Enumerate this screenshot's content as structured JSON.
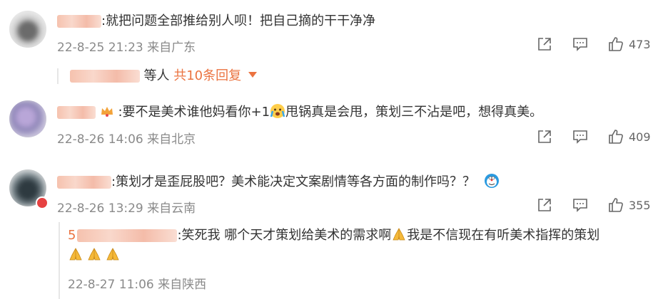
{
  "comments": [
    {
      "text": ":就把问题全部推给别人呗！把自己摘的干干净净",
      "time": "22-8-25 21:23",
      "location": "来自广东",
      "likes": "473",
      "replies_summary": {
        "suffix": "等人",
        "link": "共10条回复"
      }
    },
    {
      "text_a": ":要不是美术谁他妈看你+1",
      "text_b": "甩锅真是会甩，策划三不沾是吧，想得真美。",
      "time": "22-8-26 14:06",
      "location": "来自北京",
      "likes": "409"
    },
    {
      "text": ":策划才是歪屁股吧？美术能决定文案剧情等各方面的制作吗？？",
      "time": "22-8-26 13:29",
      "location": "来自云南",
      "likes": "355",
      "reply": {
        "name_prefix": "5",
        "text_a": ":笑死我 哪个天才策划给美术的需求啊",
        "text_b": "我是不信现在有听美术指挥的策划",
        "time": "22-8-27 11:06",
        "location": "来自陕西"
      }
    }
  ],
  "icons": [
    "share-icon",
    "comment-icon",
    "like-icon",
    "caret-down-icon",
    "pray-emoji",
    "crying-emoji",
    "crown-icon"
  ],
  "colors": {
    "accent": "#eb7340",
    "meta": "#8a8a8a",
    "text": "#333333"
  }
}
